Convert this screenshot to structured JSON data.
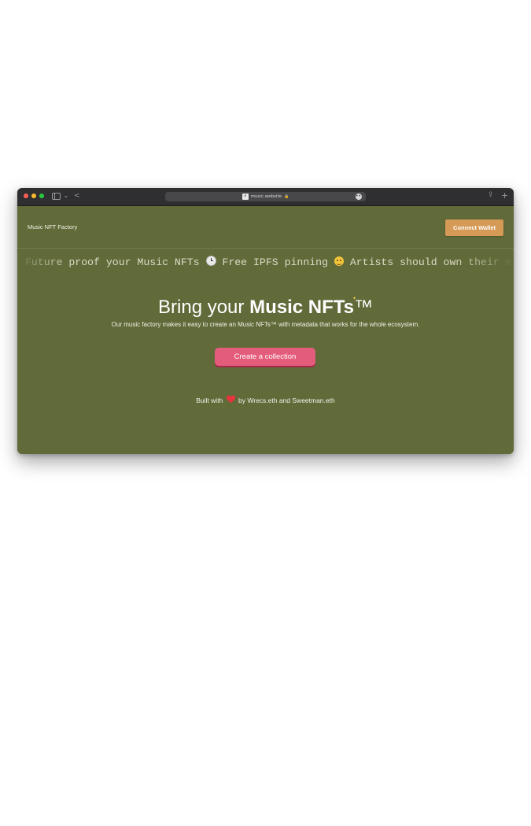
{
  "browser": {
    "url": "music.website",
    "favicon_glyph": "⚡",
    "lock_glyph": "🔒",
    "extension_glyph": "•••",
    "nav_back_glyph": "<",
    "sidebar_chevron_glyph": "⌄",
    "share_glyph": "⇪",
    "new_tab_glyph": "+"
  },
  "header": {
    "brand": "Music NFT Factory",
    "connect_wallet_label": "Connect Wallet"
  },
  "marquee": {
    "part1": "Future proof your Music NFTs",
    "part2": "Free IPFS pinning",
    "part3": "Artists should own their music"
  },
  "hero": {
    "title_prefix": "Bring your",
    "title_bold": "Music NFTs",
    "title_tm": "™",
    "sparkle_glyph": "✦",
    "subtitle": "Our music factory makes it easy to create an Music NFTs™ with metadata that works for the whole ecosystem.",
    "create_button_label": "Create a collection"
  },
  "footer": {
    "built_with": "Built with",
    "credits": "by Wrecs.eth and Sweetman.eth"
  },
  "colors": {
    "page_bg": "#616a39",
    "connect_button": "#d59a55",
    "create_button": "#e45c7b",
    "heart": "#e8343f"
  }
}
